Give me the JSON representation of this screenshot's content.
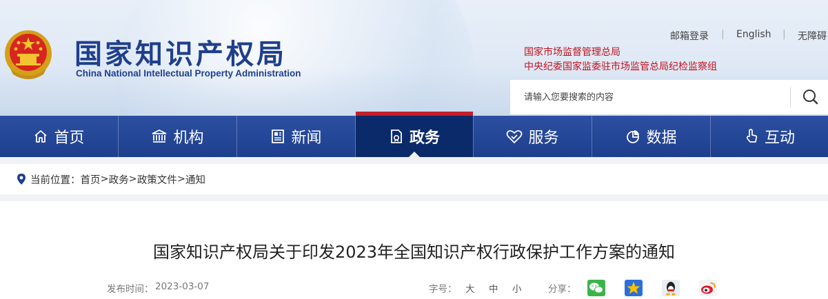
{
  "header": {
    "title": "国家知识产权局",
    "subtitle": "China National Intellectual Property Administration",
    "top_links": [
      "邮箱登录",
      "English",
      "无障碍"
    ],
    "related_links": [
      "国家市场监督管理总局",
      "中央纪委国家监委驻市场监管总局纪检监察组"
    ],
    "search": {
      "placeholder": "请输入您要搜索的内容"
    }
  },
  "nav": {
    "items": [
      {
        "label": "首页",
        "icon": "home-icon"
      },
      {
        "label": "机构",
        "icon": "institution-icon"
      },
      {
        "label": "新闻",
        "icon": "news-icon"
      },
      {
        "label": "政务",
        "icon": "government-affairs-icon"
      },
      {
        "label": "服务",
        "icon": "service-icon"
      },
      {
        "label": "数据",
        "icon": "data-pie-icon"
      },
      {
        "label": "互动",
        "icon": "interaction-icon"
      }
    ],
    "active": "政务"
  },
  "breadcrumb": {
    "prefix": "当前位置：",
    "items": [
      "首页",
      "政务",
      "政策文件",
      "通知"
    ]
  },
  "article": {
    "title": "国家知识产权局关于印发2023年全国知识产权行政保护工作方案的通知",
    "publish_label": "发布时间：",
    "publish_date": "2023-03-07",
    "font_size_label": "字号：",
    "font_sizes": [
      "大",
      "中",
      "小"
    ],
    "share_label": "分享：",
    "share_icons": [
      "wechat-icon",
      "qzone-icon",
      "qq-icon",
      "weibo-icon"
    ]
  },
  "colors": {
    "nav_blue": "#1e3f8e",
    "nav_active": "#0b2a6a",
    "accent_red": "#c41f2a",
    "title_blue": "#1f3f8c",
    "related_red": "#c1121f"
  }
}
